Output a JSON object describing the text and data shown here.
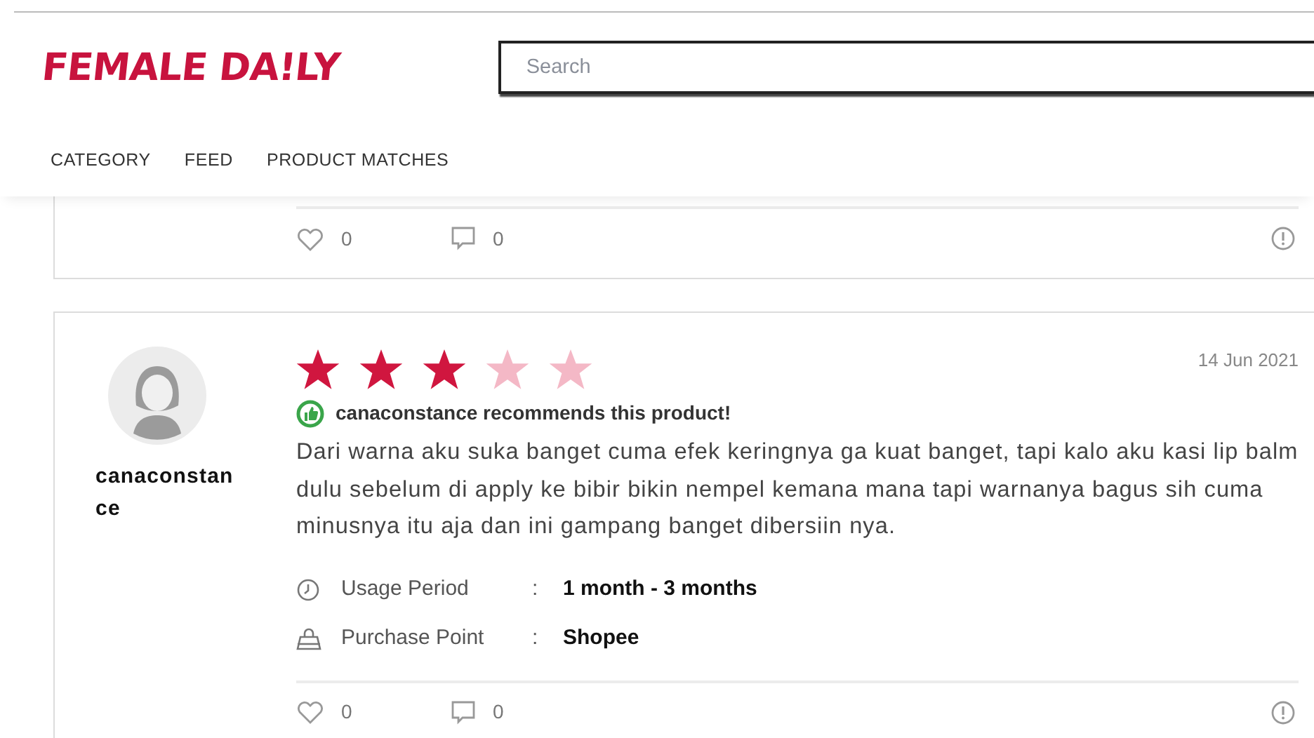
{
  "header": {
    "logo": "FEMALE DA!LY",
    "search": {
      "placeholder": "Search"
    },
    "nav": [
      {
        "label": "CATEGORY"
      },
      {
        "label": "FEED"
      },
      {
        "label": "PRODUCT MATCHES"
      }
    ]
  },
  "previous_review": {
    "likes": "0",
    "comments": "0"
  },
  "review": {
    "user": "canaconstance",
    "stars": 3,
    "date": "14 Jun 2021",
    "recommends": true,
    "recommendation": "canaconstance recommends this product!",
    "body": "Dari warna aku suka banget cuma efek keringnya ga kuat banget, tapi kalo aku kasi lip balm dulu sebelum di apply ke bibir bikin nempel kemana mana tapi warnanya bagus sih cuma minusnya itu aja dan ini gampang banget dibersiin nya.",
    "details": [
      {
        "kind": "clock",
        "label": "Usage Period",
        "separator": ":",
        "value": "1 month - 3 months"
      },
      {
        "kind": "bag",
        "label": "Purchase Point",
        "separator": ":",
        "value": "Shopee"
      }
    ],
    "likes": "0",
    "comments": "0"
  }
}
